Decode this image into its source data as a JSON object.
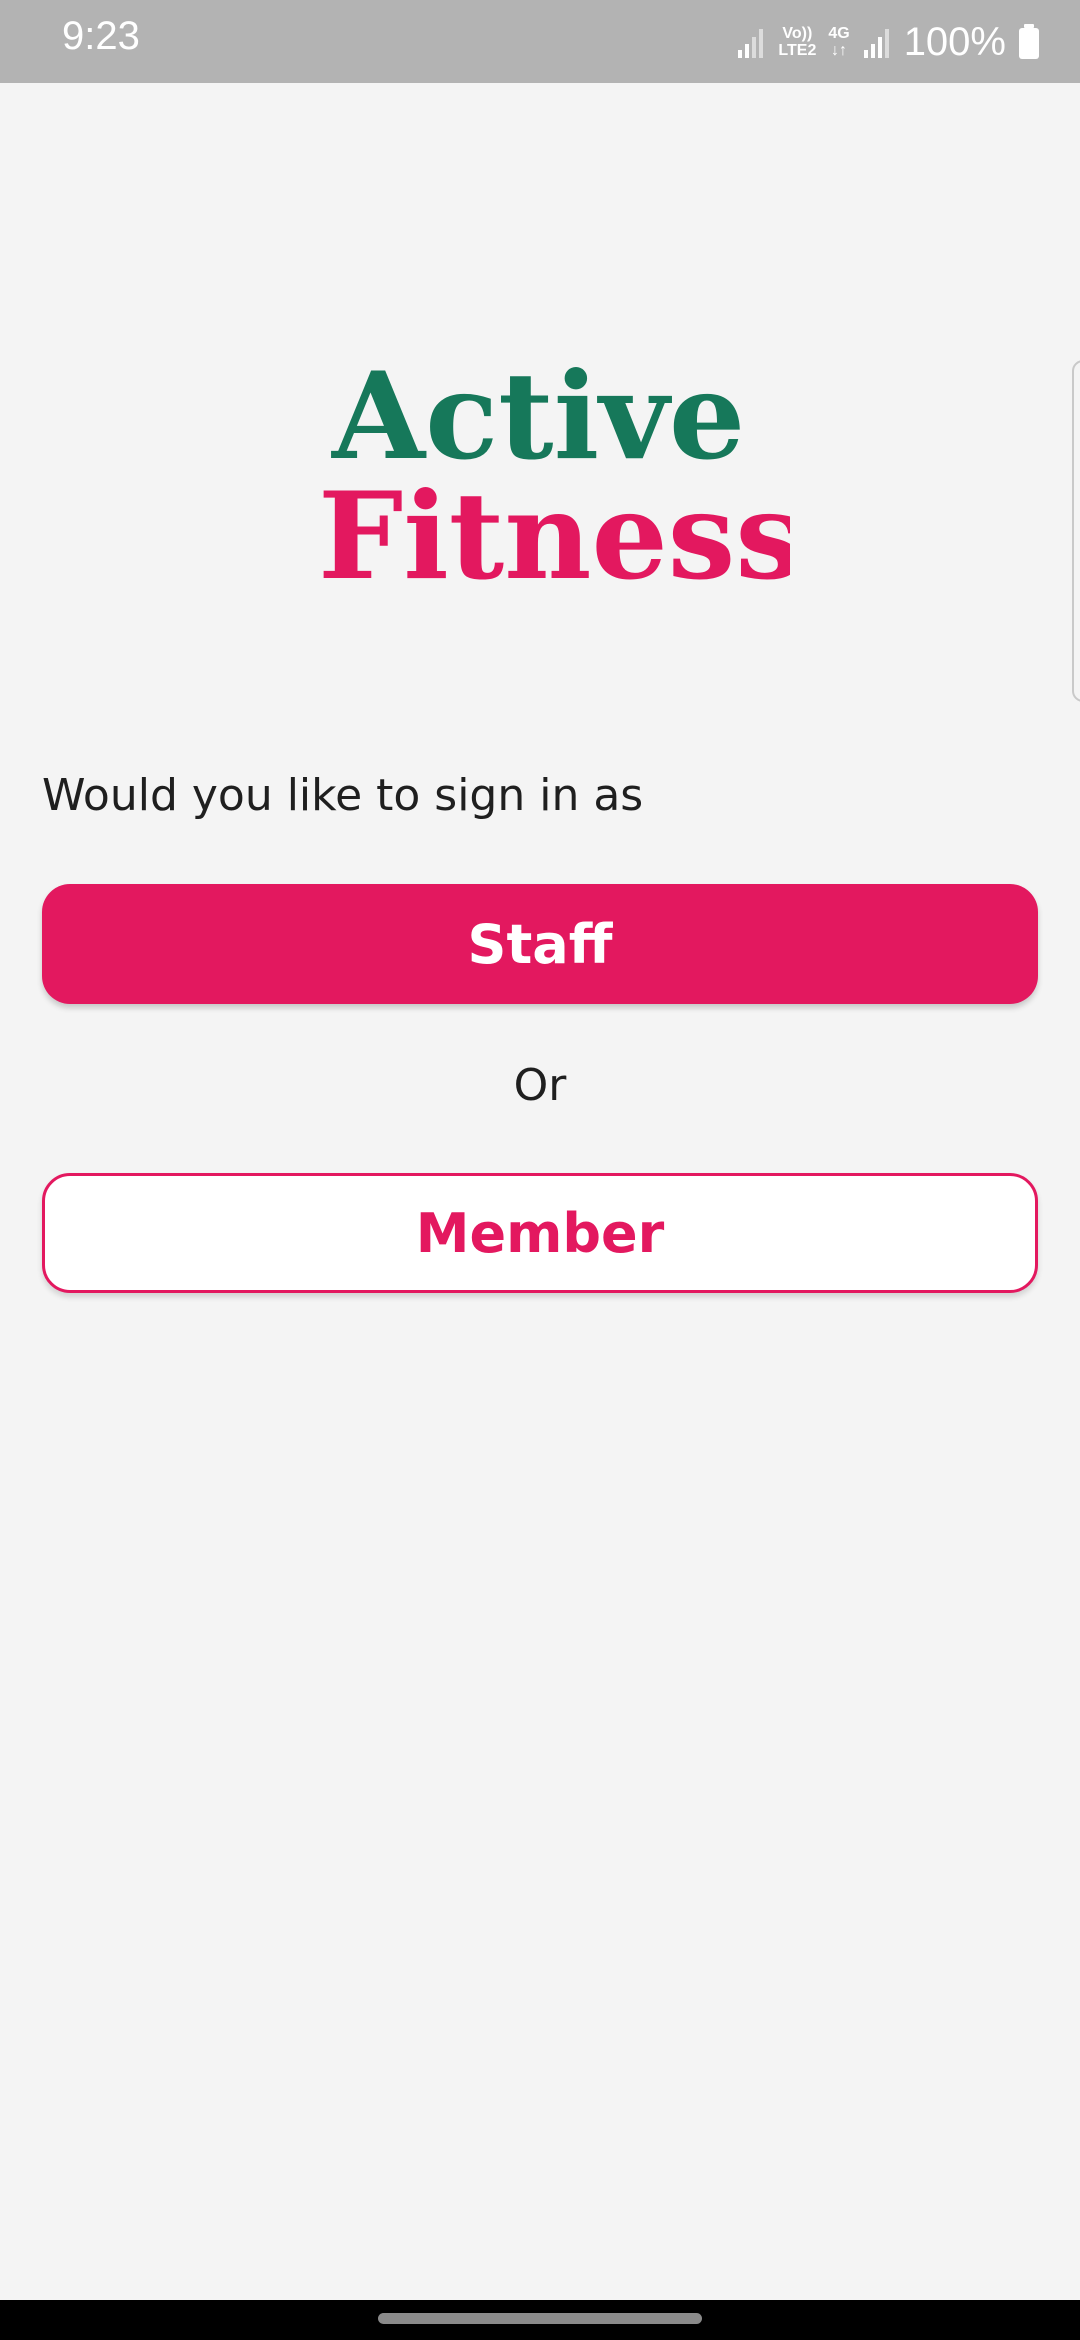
{
  "status_bar": {
    "time": "9:23",
    "volte_top": "Vo))",
    "volte_bottom": "LTE2",
    "net_top": "4G",
    "net_bottom": "↓↑",
    "battery": "100%"
  },
  "logo": {
    "line1": "Active",
    "line2": "Fitness",
    "colors": {
      "green": "#16785a",
      "pink": "#e3185f"
    }
  },
  "main": {
    "prompt": "Would you like to sign in as",
    "staff_label": "Staff",
    "or_label": "Or",
    "member_label": "Member"
  },
  "colors": {
    "accent": "#e3185f",
    "background": "#f4f4f4",
    "status_bar": "#b3b3b3"
  }
}
